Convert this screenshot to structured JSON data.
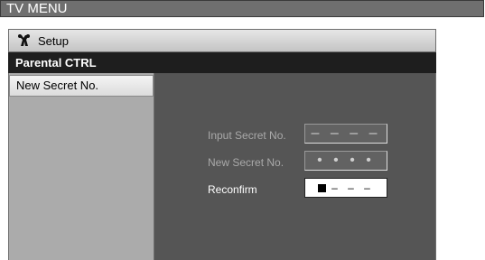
{
  "window": {
    "title": "TV MENU"
  },
  "setup": {
    "label": "Setup",
    "icon": "wrench-icon"
  },
  "section": {
    "title": "Parental CTRL"
  },
  "sidebar": {
    "items": [
      {
        "label": "New Secret No."
      }
    ]
  },
  "form": {
    "input_secret": {
      "label": "Input Secret No.",
      "value": "– – – –"
    },
    "new_secret": {
      "label": "New Secret No.",
      "value": "• • • •"
    },
    "reconfirm": {
      "label": "Reconfirm",
      "value": "– – –"
    }
  },
  "colors": {
    "content_bg": "#555555",
    "section_bar": "#1e1e1e",
    "title_bar": "#6f6f6f"
  }
}
